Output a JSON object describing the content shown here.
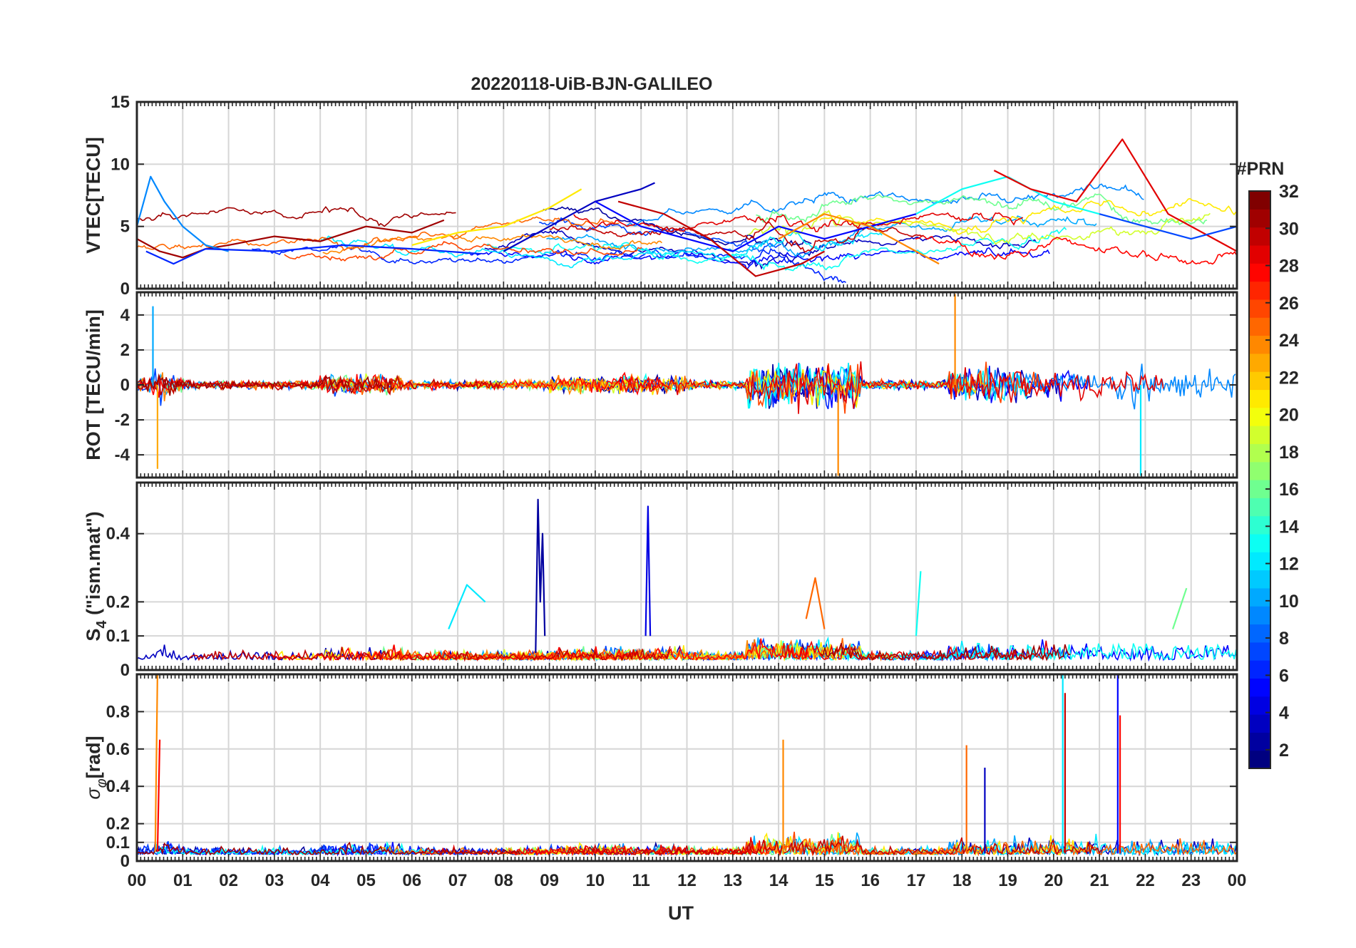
{
  "figure": {
    "title": "20220118-UiB-BJN-GALILEO",
    "xlabel": "UT",
    "x_ticks": [
      "00",
      "01",
      "02",
      "03",
      "04",
      "05",
      "06",
      "07",
      "08",
      "09",
      "10",
      "11",
      "12",
      "13",
      "14",
      "15",
      "16",
      "17",
      "18",
      "19",
      "20",
      "21",
      "22",
      "23",
      "00"
    ]
  },
  "colorbar": {
    "title": "#PRN",
    "ticks": [
      "2",
      "4",
      "6",
      "8",
      "10",
      "12",
      "14",
      "16",
      "18",
      "20",
      "22",
      "24",
      "26",
      "28",
      "30",
      "32"
    ],
    "range": [
      1,
      32
    ],
    "colormap": "jet"
  },
  "chart_data": [
    {
      "type": "line",
      "panel": "VTEC",
      "ylabel": "VTEC[TECU]",
      "ylim": [
        0,
        15
      ],
      "y_ticks": [
        "0",
        "5",
        "10",
        "15"
      ],
      "xlim": [
        0,
        24
      ],
      "grid": true,
      "series": [
        {
          "prn": 31,
          "x": [
            0.0,
            0.5,
            1.0,
            1.5,
            2.0,
            3.0,
            4.0,
            5.0,
            6.0,
            6.7
          ],
          "y": [
            4,
            3,
            2.5,
            3.2,
            3.5,
            4.2,
            3.8,
            5,
            4.5,
            5.5
          ]
        },
        {
          "prn": 9,
          "x": [
            0.0,
            0.3,
            0.6,
            1.0,
            1.5,
            2.0
          ],
          "y": [
            5,
            9,
            7,
            5,
            3.5,
            3
          ]
        },
        {
          "prn": 6,
          "x": [
            0.2,
            0.8,
            1.5,
            3.0,
            4.5,
            6.0,
            7.5
          ],
          "y": [
            3,
            2,
            3.2,
            3,
            3.5,
            3.2,
            2.8
          ]
        },
        {
          "prn": 21,
          "x": [
            6.0,
            7.0,
            8.0,
            9.0,
            9.7
          ],
          "y": [
            3.5,
            4.5,
            5,
            6.5,
            8
          ]
        },
        {
          "prn": 3,
          "x": [
            8.0,
            9.0,
            10.0,
            11.0,
            11.3
          ],
          "y": [
            3,
            5,
            7,
            8,
            8.5
          ]
        },
        {
          "prn": 5,
          "x": [
            10.0,
            11.0,
            12.0,
            13.0,
            14.0,
            15.0,
            16.0,
            17.0
          ],
          "y": [
            7,
            5,
            4,
            3,
            5,
            4,
            5,
            6
          ]
        },
        {
          "prn": 30,
          "x": [
            10.5,
            11.5,
            12.5,
            13.5,
            14.5,
            15.0
          ],
          "y": [
            7,
            6,
            4,
            1,
            2,
            3
          ]
        },
        {
          "prn": 24,
          "x": [
            14.0,
            15.0,
            16.0,
            17.0,
            17.5
          ],
          "y": [
            4,
            6,
            5,
            3,
            2
          ]
        },
        {
          "prn": 13,
          "x": [
            17.0,
            18.0,
            19.0,
            20.0,
            21.0
          ],
          "y": [
            6,
            8,
            9,
            7,
            6
          ]
        },
        {
          "prn": 29,
          "x": [
            18.7,
            19.5,
            20.5,
            21.5,
            22.5,
            23.5,
            24.0
          ],
          "y": [
            9.5,
            8,
            7,
            12,
            6,
            4,
            3
          ]
        },
        {
          "prn": 7,
          "x": [
            21.0,
            22.0,
            23.0,
            24.0
          ],
          "y": [
            6,
            5,
            4,
            5
          ]
        }
      ]
    },
    {
      "type": "line",
      "panel": "ROT",
      "ylabel": "ROT [TECU/min]",
      "ylim": [
        -5.3,
        5.3
      ],
      "y_ticks": [
        "-4",
        "-2",
        "0",
        "2",
        "4"
      ],
      "xlim": [
        0,
        24
      ],
      "grid": true,
      "series": [
        {
          "prn": 10,
          "x": [
            0.35
          ],
          "y": [
            4.5
          ]
        },
        {
          "prn": 23,
          "x": [
            0.45
          ],
          "y": [
            -4.8
          ]
        },
        {
          "prn": 24,
          "x": [
            15.3
          ],
          "y": [
            -5.2
          ]
        },
        {
          "prn": 24,
          "x": [
            17.85
          ],
          "y": [
            5.2
          ]
        },
        {
          "prn": 12,
          "x": [
            21.9
          ],
          "y": [
            -5.2
          ]
        }
      ]
    },
    {
      "type": "line",
      "panel": "S4",
      "ylabel": "S4 (\"ism.mat\")",
      "ylabel_main": "S",
      "ylabel_sub": "4",
      "ylabel_rest": " (\"ism.mat\")",
      "ylim": [
        0,
        0.55
      ],
      "y_ticks": [
        "0",
        "0.1",
        "0.2",
        "0.4"
      ],
      "xlim": [
        0,
        24
      ],
      "grid": true,
      "series": [
        {
          "prn": 2,
          "x": [
            8.7,
            8.75,
            8.8,
            8.85,
            8.9
          ],
          "y": [
            0.05,
            0.5,
            0.2,
            0.4,
            0.1
          ]
        },
        {
          "prn": 4,
          "x": [
            11.1,
            11.15,
            11.2
          ],
          "y": [
            0.1,
            0.48,
            0.1
          ]
        },
        {
          "prn": 12,
          "x": [
            6.8,
            7.2,
            7.6
          ],
          "y": [
            0.12,
            0.25,
            0.2
          ]
        },
        {
          "prn": 25,
          "x": [
            14.6,
            14.8,
            15.0
          ],
          "y": [
            0.15,
            0.27,
            0.12
          ]
        },
        {
          "prn": 13,
          "x": [
            17.0,
            17.1
          ],
          "y": [
            0.1,
            0.29
          ]
        },
        {
          "prn": 16,
          "x": [
            22.6,
            22.9
          ],
          "y": [
            0.12,
            0.24
          ]
        }
      ]
    },
    {
      "type": "line",
      "panel": "sigma_phi",
      "ylabel": "σφ[rad]",
      "ylabel_main": "σ",
      "ylabel_sub": "φ",
      "ylabel_rest": "[rad]",
      "ylim": [
        0,
        1.0
      ],
      "y_ticks": [
        "0",
        "0.1",
        "0.2",
        "0.4",
        "0.6",
        "0.8"
      ],
      "xlim": [
        0,
        24
      ],
      "grid": true,
      "series": [
        {
          "prn": 24,
          "x": [
            0.4,
            0.45
          ],
          "y": [
            0.05,
            1.0
          ]
        },
        {
          "prn": 28,
          "x": [
            0.45,
            0.5
          ],
          "y": [
            0.05,
            0.65
          ]
        },
        {
          "prn": 24,
          "x": [
            14.1
          ],
          "y": [
            0.65
          ]
        },
        {
          "prn": 25,
          "x": [
            18.1
          ],
          "y": [
            0.62
          ]
        },
        {
          "prn": 3,
          "x": [
            18.5
          ],
          "y": [
            0.5
          ]
        },
        {
          "prn": 12,
          "x": [
            20.2
          ],
          "y": [
            1.0
          ]
        },
        {
          "prn": 30,
          "x": [
            20.25
          ],
          "y": [
            0.9
          ]
        },
        {
          "prn": 5,
          "x": [
            21.4
          ],
          "y": [
            1.0
          ]
        },
        {
          "prn": 28,
          "x": [
            21.45
          ],
          "y": [
            0.78
          ]
        }
      ]
    }
  ]
}
